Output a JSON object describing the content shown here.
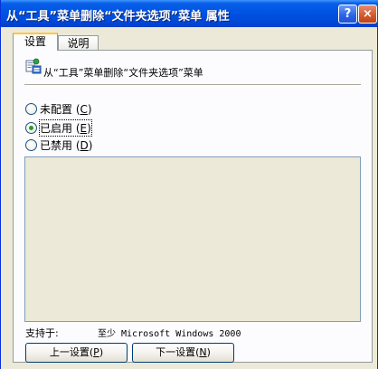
{
  "window": {
    "title": "从“工具”菜单删除“文件夹选项”菜单 属性",
    "help_glyph": "?",
    "close_glyph": "×"
  },
  "tabs": [
    {
      "label": "设置",
      "active": true
    },
    {
      "label": "说明",
      "active": false
    }
  ],
  "policy": {
    "title": "从“工具”菜单删除“文件夹选项”菜单",
    "icon": "policy-settings-icon"
  },
  "options": [
    {
      "label": "未配置",
      "key": "C",
      "checked": false
    },
    {
      "label": "已启用",
      "key": "E",
      "checked": true
    },
    {
      "label": "已禁用",
      "key": "D",
      "checked": false
    }
  ],
  "supported": {
    "label": "支持于:",
    "value": "至少 Microsoft Windows 2000"
  },
  "buttons": {
    "prev": {
      "label": "上一设置",
      "key": "P"
    },
    "next": {
      "label": "下一设置",
      "key": "N"
    }
  },
  "colors": {
    "titlebar": "#0055e5",
    "dialog_bg": "#ece9d8",
    "active_tab_highlight": "#ffc83c",
    "radio_check": "#21a121"
  }
}
